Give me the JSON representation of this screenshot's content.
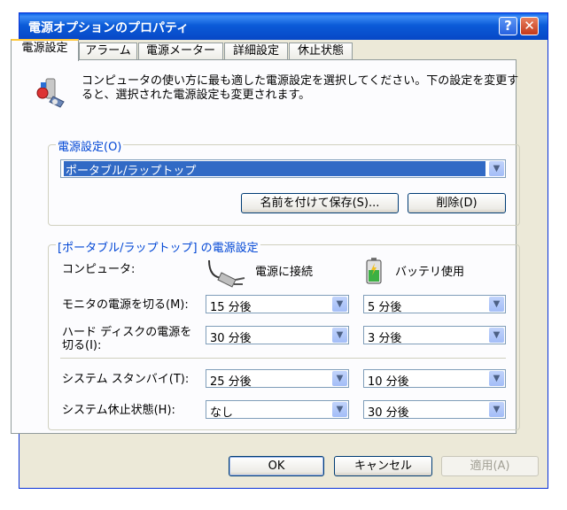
{
  "window": {
    "title": "電源オプションのプロパティ",
    "help_label": "?",
    "close_label": "✕"
  },
  "tabs": [
    {
      "label": "電源設定"
    },
    {
      "label": "アラーム"
    },
    {
      "label": "電源メーター"
    },
    {
      "label": "詳細設定"
    },
    {
      "label": "休止状態"
    }
  ],
  "description": "コンピュータの使い方に最も適した電源設定を選択してください。下の設定を変更すると、選択された電源設定も変更されます。",
  "power_scheme": {
    "group_label": "電源設定(O)",
    "selected": "ポータブル/ラップトップ",
    "save_as_label": "名前を付けて保存(S)...",
    "delete_label": "削除(D)"
  },
  "settings": {
    "group_label": "[ポータブル/ラップトップ] の電源設定",
    "computer_label": "コンピュータ:",
    "plugged_in_label": "電源に接続",
    "battery_label": "バッテリ使用",
    "rows": [
      {
        "label": "モニタの電源を切る(M):",
        "ac": "15 分後",
        "dc": "5 分後"
      },
      {
        "label": "ハード ディスクの電源を切る(I):",
        "ac": "30 分後",
        "dc": "3 分後"
      },
      {
        "label": "システム スタンバイ(T):",
        "ac": "25 分後",
        "dc": "10 分後"
      },
      {
        "label": "システム休止状態(H):",
        "ac": "なし",
        "dc": "30 分後"
      }
    ]
  },
  "footer": {
    "ok_label": "OK",
    "cancel_label": "キャンセル",
    "apply_label": "適用(A)"
  }
}
